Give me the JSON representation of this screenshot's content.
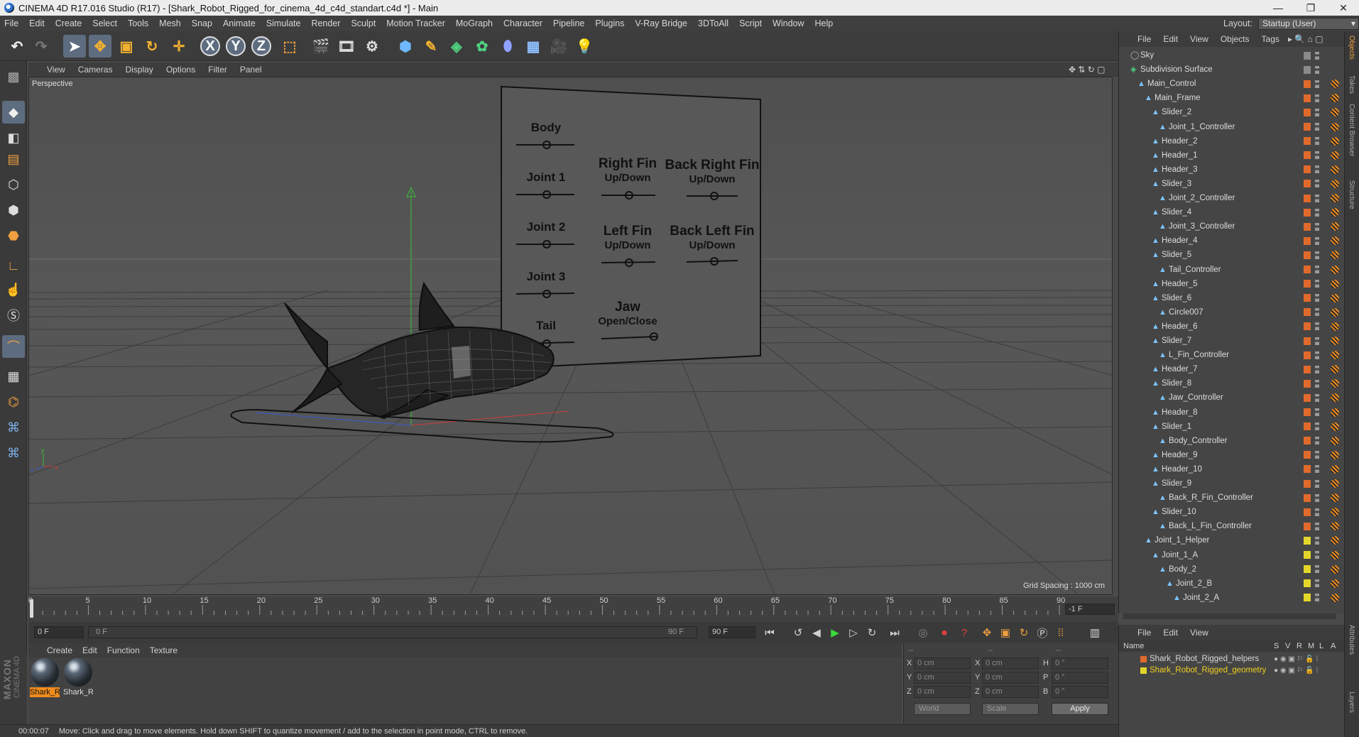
{
  "window": {
    "title": "CINEMA 4D R17.016 Studio (R17) - [Shark_Robot_Rigged_for_cinema_4d_c4d_standart.c4d *] - Main"
  },
  "menu": [
    "File",
    "Edit",
    "Create",
    "Select",
    "Tools",
    "Mesh",
    "Snap",
    "Animate",
    "Simulate",
    "Render",
    "Sculpt",
    "Motion Tracker",
    "MoGraph",
    "Character",
    "Pipeline",
    "Plugins",
    "V-Ray Bridge",
    "3DToAll",
    "Script",
    "Window",
    "Help"
  ],
  "layout": {
    "label": "Layout:",
    "value": "Startup (User)"
  },
  "toolbar": {
    "x_label": "X",
    "y_label": "Y",
    "z_label": "Z"
  },
  "viewport": {
    "menu": [
      "View",
      "Cameras",
      "Display",
      "Options",
      "Filter",
      "Panel"
    ],
    "label": "Perspective",
    "grid_spacing": "Grid Spacing : 1000 cm",
    "axis": {
      "x": "x",
      "y": "y",
      "z": "z"
    },
    "panel": {
      "body": "Body",
      "joint1": "Joint 1",
      "joint2": "Joint 2",
      "joint3": "Joint 3",
      "tail": "Tail",
      "right_fin": "Right Fin",
      "up_down": "Up/Down",
      "left_fin": "Left Fin",
      "jaw": "Jaw",
      "open_close": "Open/Close",
      "back_right_fin": "Back Right Fin",
      "back_left_fin": "Back Left Fin"
    }
  },
  "timeline": {
    "ticks": [
      "0",
      "5",
      "10",
      "15",
      "20",
      "25",
      "30",
      "35",
      "40",
      "45",
      "50",
      "55",
      "60",
      "65",
      "70",
      "75",
      "80",
      "85",
      "90"
    ],
    "end_field": "-1 F"
  },
  "transport": {
    "current": "0 F",
    "start": "0 F",
    "end_inner": "90 F",
    "end": "90 F"
  },
  "materials": {
    "menu": [
      "Create",
      "Edit",
      "Function",
      "Texture"
    ],
    "items": [
      "Shark_R",
      "Shark_R"
    ]
  },
  "coords": {
    "headers": [
      "--",
      "--",
      "--"
    ],
    "rows": [
      {
        "a": "X",
        "av": "0 cm",
        "b": "X",
        "bv": "0 cm",
        "c": "H",
        "cv": "0 °"
      },
      {
        "a": "Y",
        "av": "0 cm",
        "b": "Y",
        "bv": "0 cm",
        "c": "P",
        "cv": "0 °"
      },
      {
        "a": "Z",
        "av": "0 cm",
        "b": "Z",
        "bv": "0 cm",
        "c": "B",
        "cv": "0 °"
      }
    ],
    "world": "World",
    "scale": "Scale",
    "apply": "Apply"
  },
  "brand": {
    "maxon": "MAXON",
    "cinema": "CINEMA 4D"
  },
  "status": {
    "time": "00:00:07",
    "message": "Move: Click and drag to move elements. Hold down SHIFT to quantize movement / add to the selection in point mode, CTRL to remove."
  },
  "objects": {
    "menu": [
      "File",
      "Edit",
      "View",
      "Objects",
      "Tags"
    ],
    "items": [
      {
        "name": "Sky",
        "depth": 0,
        "color": "#8a8a8a"
      },
      {
        "name": "Subdivision Surface",
        "depth": 0,
        "color": "#8a8a8a"
      },
      {
        "name": "Main_Control",
        "depth": 1,
        "color": "#e06a2c"
      },
      {
        "name": "Main_Frame",
        "depth": 2,
        "color": "#e06a2c"
      },
      {
        "name": "Slider_2",
        "depth": 3,
        "color": "#e06a2c"
      },
      {
        "name": "Joint_1_Controller",
        "depth": 4,
        "color": "#e06a2c"
      },
      {
        "name": "Header_2",
        "depth": 3,
        "color": "#e06a2c"
      },
      {
        "name": "Header_1",
        "depth": 3,
        "color": "#e06a2c"
      },
      {
        "name": "Header_3",
        "depth": 3,
        "color": "#e06a2c"
      },
      {
        "name": "Slider_3",
        "depth": 3,
        "color": "#e06a2c"
      },
      {
        "name": "Joint_2_Controller",
        "depth": 4,
        "color": "#e06a2c"
      },
      {
        "name": "Slider_4",
        "depth": 3,
        "color": "#e06a2c"
      },
      {
        "name": "Joint_3_Controller",
        "depth": 4,
        "color": "#e06a2c"
      },
      {
        "name": "Header_4",
        "depth": 3,
        "color": "#e06a2c"
      },
      {
        "name": "Slider_5",
        "depth": 3,
        "color": "#e06a2c"
      },
      {
        "name": "Tail_Controller",
        "depth": 4,
        "color": "#e06a2c"
      },
      {
        "name": "Header_5",
        "depth": 3,
        "color": "#e06a2c"
      },
      {
        "name": "Slider_6",
        "depth": 3,
        "color": "#e06a2c"
      },
      {
        "name": "Circle007",
        "depth": 4,
        "color": "#e06a2c"
      },
      {
        "name": "Header_6",
        "depth": 3,
        "color": "#e06a2c"
      },
      {
        "name": "Slider_7",
        "depth": 3,
        "color": "#e06a2c"
      },
      {
        "name": "L_Fin_Controller",
        "depth": 4,
        "color": "#e06a2c"
      },
      {
        "name": "Header_7",
        "depth": 3,
        "color": "#e06a2c"
      },
      {
        "name": "Slider_8",
        "depth": 3,
        "color": "#e06a2c"
      },
      {
        "name": "Jaw_Controller",
        "depth": 4,
        "color": "#e06a2c"
      },
      {
        "name": "Header_8",
        "depth": 3,
        "color": "#e06a2c"
      },
      {
        "name": "Slider_1",
        "depth": 3,
        "color": "#e06a2c"
      },
      {
        "name": "Body_Controller",
        "depth": 4,
        "color": "#e06a2c"
      },
      {
        "name": "Header_9",
        "depth": 3,
        "color": "#e06a2c"
      },
      {
        "name": "Header_10",
        "depth": 3,
        "color": "#e06a2c"
      },
      {
        "name": "Slider_9",
        "depth": 3,
        "color": "#e06a2c"
      },
      {
        "name": "Back_R_Fin_Controller",
        "depth": 4,
        "color": "#e06a2c"
      },
      {
        "name": "Slider_10",
        "depth": 3,
        "color": "#e06a2c"
      },
      {
        "name": "Back_L_Fin_Controller",
        "depth": 4,
        "color": "#e06a2c"
      },
      {
        "name": "Joint_1_Helper",
        "depth": 2,
        "color": "#e3d62a"
      },
      {
        "name": "Joint_1_A",
        "depth": 3,
        "color": "#e3d62a"
      },
      {
        "name": "Body_2",
        "depth": 4,
        "color": "#e3d62a"
      },
      {
        "name": "Joint_2_B",
        "depth": 5,
        "color": "#e3d62a"
      },
      {
        "name": "Joint_2_A",
        "depth": 6,
        "color": "#e3d62a"
      }
    ]
  },
  "layers": {
    "menu": [
      "File",
      "Edit",
      "View"
    ],
    "header": {
      "name": "Name",
      "cols": [
        "S",
        "V",
        "R",
        "M",
        "L",
        "A"
      ]
    },
    "items": [
      {
        "name": "Shark_Robot_Rigged_helpers",
        "color": "#e06a2c"
      },
      {
        "name": "Shark_Robot_Rigged_geometry",
        "color": "#e3d62a"
      }
    ]
  },
  "side_tabs": [
    "Objects",
    "Takes",
    "Content Browser",
    "Structure",
    "Attributes",
    "Layers"
  ],
  "colors": {
    "accent": "#f08c1e",
    "selected_tool": "#5e6c80",
    "axis_x": "#d23a3a",
    "axis_y": "#3bbf3b",
    "axis_z": "#3a5ad2"
  }
}
